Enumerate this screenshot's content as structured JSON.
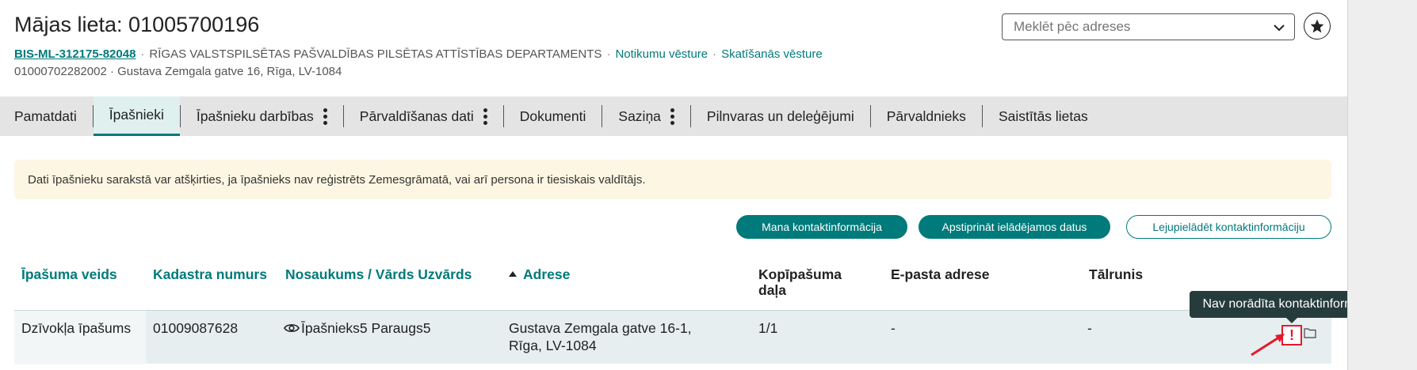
{
  "header": {
    "title": "Mājas lieta: 01005700196",
    "case_id": "BIS-ML-312175-82048",
    "department": "RĪGAS VALSTSPILSĒTAS PAŠVALDĪBAS PILSĒTAS ATTĪSTĪBAS DEPARTAMENTS",
    "link_events": "Notikumu vēsture",
    "link_views": "Skatīšanās vēsture",
    "separator": "·",
    "address_line": "01000702282002 · Gustava Zemgala gatve 16, Rīga, LV-1084"
  },
  "search": {
    "placeholder": "Meklēt pēc adreses",
    "icon": "chevron-down-icon"
  },
  "favorite": {
    "icon": "star-icon"
  },
  "tabs": [
    {
      "label": "Pamatdati",
      "active": false,
      "menu": false
    },
    {
      "label": "Īpašnieki",
      "active": true,
      "menu": false
    },
    {
      "label": "Īpašnieku darbības",
      "active": false,
      "menu": true
    },
    {
      "label": "Pārvaldīšanas dati",
      "active": false,
      "menu": true
    },
    {
      "label": "Dokumenti",
      "active": false,
      "menu": false
    },
    {
      "label": "Saziņa",
      "active": false,
      "menu": true
    },
    {
      "label": "Pilnvaras un deleģējumi",
      "active": false,
      "menu": false
    },
    {
      "label": "Pārvaldnieks",
      "active": false,
      "menu": false
    },
    {
      "label": "Saistītās lietas",
      "active": false,
      "menu": false
    }
  ],
  "notice": "Dati īpašnieku sarakstā var atšķirties, ja īpašnieks nav reģistrēts Zemesgrāmatā, vai arī persona ir tiesiskais valdītājs.",
  "actions": {
    "my_contact": "Mana kontaktinformācija",
    "confirm_data": "Apstiprināt ielādējamos datus",
    "download_contact": "Lejupielādēt kontaktinformāciju"
  },
  "table": {
    "columns": [
      "Īpašuma veids",
      "Kadastra numurs",
      "Nosaukums / Vārds Uzvārds",
      "Adrese",
      "Kopīpašuma daļa",
      "E-pasta adrese",
      "Tālrunis"
    ],
    "rows": [
      {
        "property_type": "Dzīvokļa īpašums",
        "cadastre": "01009087628",
        "owner": "Īpašnieks5 Paraugs5",
        "address": "Gustava Zemgala gatve 16-1, Rīga, LV-1084",
        "share": "1/1",
        "email": "-",
        "phone": "-"
      }
    ]
  },
  "tooltip": "Nav norādīta kontaktinformācija",
  "warning_mark": "!",
  "colors": {
    "accent": "#007a7a",
    "warning": "#e4192b",
    "notice_bg": "#fdf6e3",
    "tooltip_bg": "#263c3c"
  }
}
